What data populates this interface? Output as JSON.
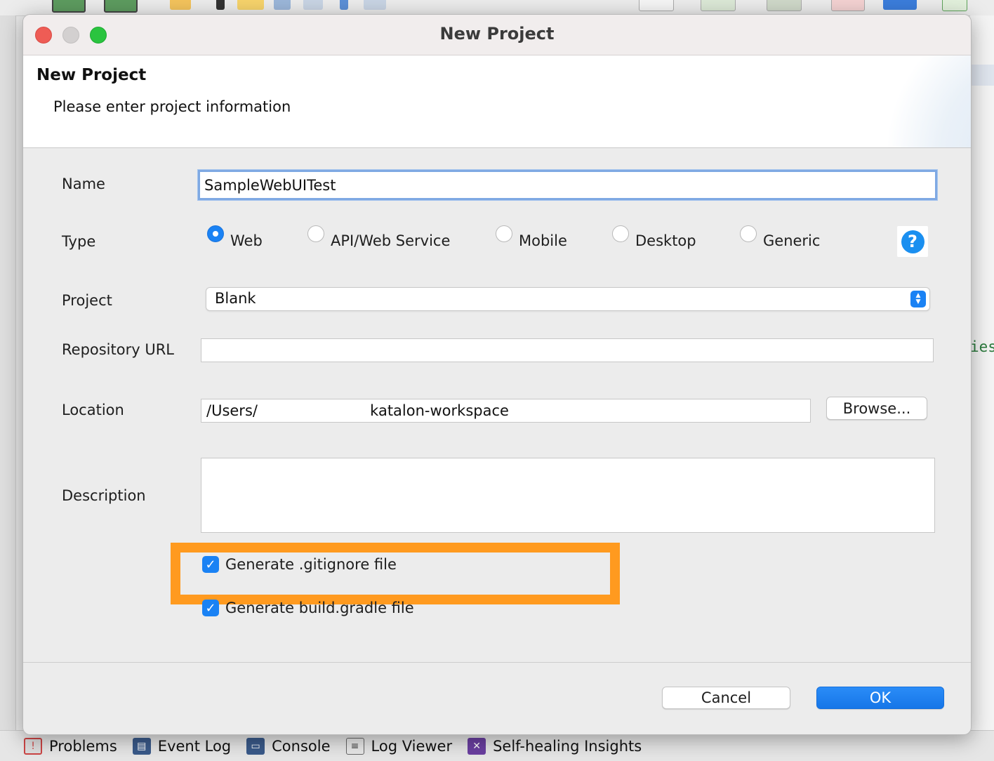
{
  "dialog": {
    "window_title": "New Project",
    "banner_title": "New Project",
    "banner_subtitle": "Please enter project information"
  },
  "form": {
    "name_label": "Name",
    "name_value": "SampleWebUITest",
    "type_label": "Type",
    "type_options": [
      "Web",
      "API/Web Service",
      "Mobile",
      "Desktop",
      "Generic"
    ],
    "type_selected": "Web",
    "help_symbol": "?",
    "project_label": "Project",
    "project_value": "Blank",
    "repository_label": "Repository URL",
    "repository_value": "",
    "location_label": "Location",
    "location_value": "/Users/                        katalon-workspace",
    "browse_label": "Browse...",
    "description_label": "Description",
    "description_value": "",
    "gitignore_label": "Generate .gitignore file",
    "gitignore_checked": true,
    "gradle_label": "Generate build.gradle file",
    "gradle_checked": true
  },
  "buttons": {
    "cancel": "Cancel",
    "ok": "OK"
  },
  "bottom_tabs": [
    {
      "label": "Problems",
      "icon": "problems-icon"
    },
    {
      "label": "Event Log",
      "icon": "event-log-icon"
    },
    {
      "label": "Console",
      "icon": "console-icon"
    },
    {
      "label": "Log Viewer",
      "icon": "log-viewer-icon"
    },
    {
      "label": "Self-healing Insights",
      "icon": "self-healing-icon"
    }
  ],
  "background": {
    "right_code_text": "ies"
  },
  "colors": {
    "accent": "#1a82f4",
    "highlight": "#ff9a1f",
    "dialog_bg": "#ececec"
  }
}
